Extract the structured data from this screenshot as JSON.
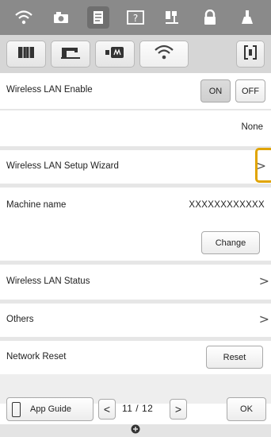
{
  "top_icons": [
    {
      "name": "wifi-icon"
    },
    {
      "name": "camera-icon"
    },
    {
      "name": "document-icon"
    },
    {
      "name": "help-icon"
    },
    {
      "name": "needle-icon"
    },
    {
      "name": "lock-icon"
    },
    {
      "name": "presser-foot-icon"
    }
  ],
  "subtabs": [
    {
      "name": "book-icon"
    },
    {
      "name": "sewing-machine-icon"
    },
    {
      "name": "embroidery-frame-icon"
    },
    {
      "name": "wifi-icon"
    },
    {
      "name": "bracket-icon"
    }
  ],
  "settings": {
    "wireless_lan_enable": {
      "label": "Wireless LAN Enable",
      "on": "ON",
      "off": "OFF",
      "status": "None"
    },
    "setup_wizard": {
      "label": "Wireless LAN Setup Wizard"
    },
    "machine_name": {
      "label": "Machine name",
      "value": "XXXXXXXXXXXX",
      "change": "Change"
    },
    "lan_status": {
      "label": "Wireless LAN Status"
    },
    "others": {
      "label": "Others"
    },
    "network_reset": {
      "label": "Network Reset",
      "reset": "Reset"
    }
  },
  "footer": {
    "app_guide": "App Guide",
    "page": "11 / 12",
    "ok": "OK"
  },
  "colors": {
    "highlight": "#e0a400",
    "topbar": "#8a8a8a"
  }
}
